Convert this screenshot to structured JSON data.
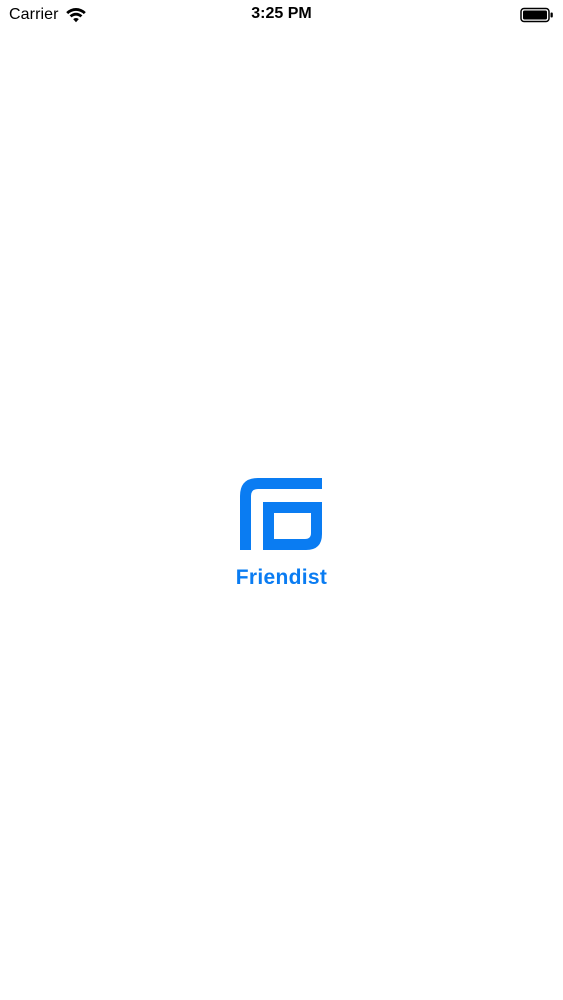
{
  "status_bar": {
    "carrier": "Carrier",
    "time": "3:25 PM",
    "wifi_icon": "wifi-icon",
    "battery_icon": "battery-icon"
  },
  "splash": {
    "logo_icon": "friendist-logo-icon",
    "app_name": "Friendist",
    "brand_color": "#0A7CF2"
  },
  "colors": {
    "background": "#FFFFFF",
    "status_text": "#000000"
  }
}
